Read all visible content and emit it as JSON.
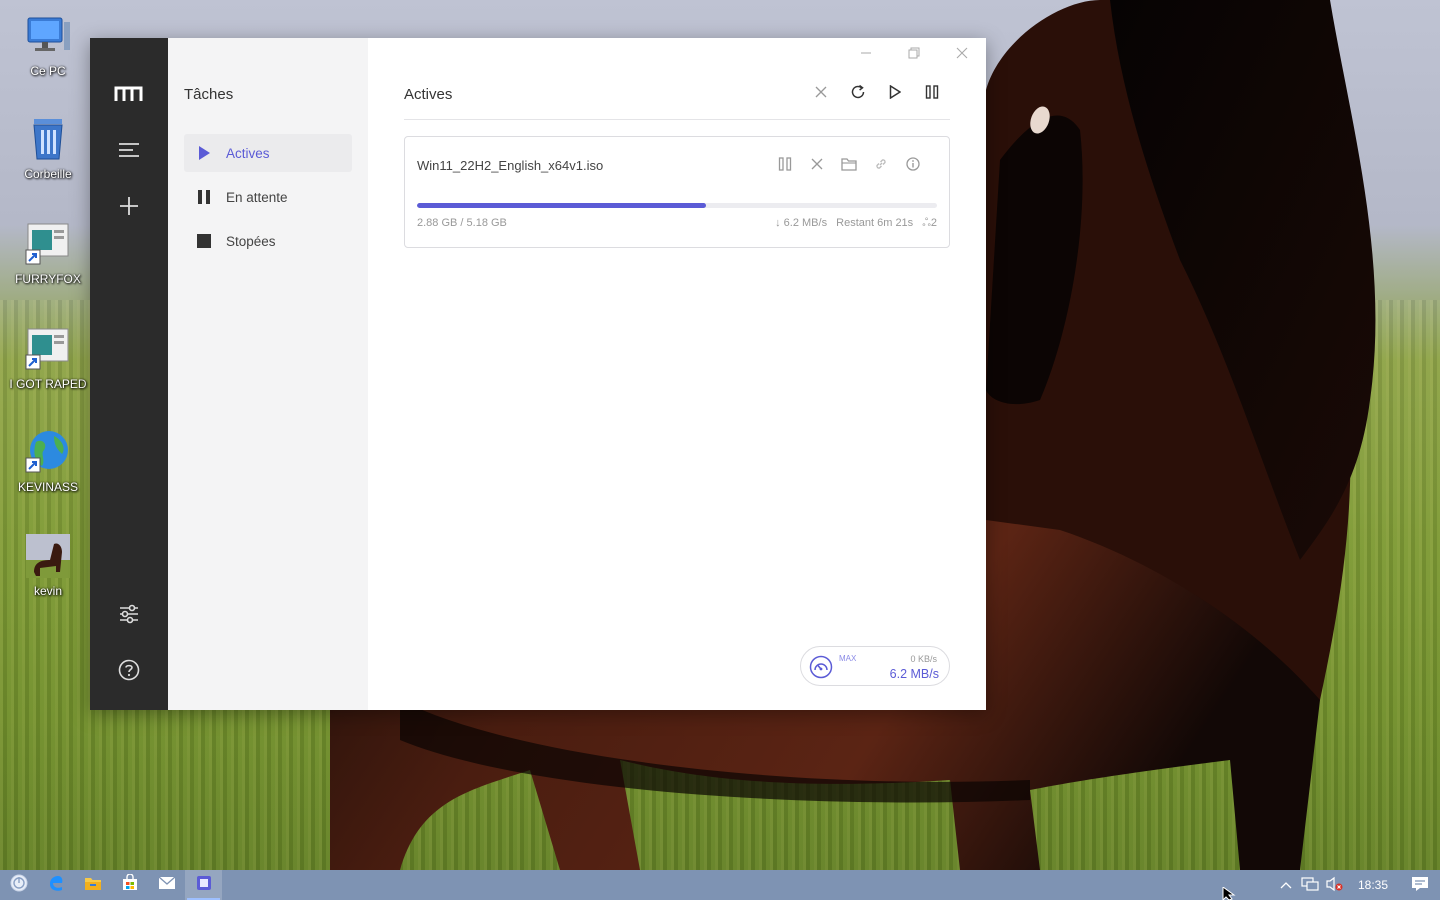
{
  "desktop": {
    "icons": [
      {
        "label": "Ce PC",
        "icon": "computer-icon"
      },
      {
        "label": "Corbeille",
        "icon": "recycle-bin-icon"
      },
      {
        "label": "FURRYFOX",
        "icon": "shortcut-icon"
      },
      {
        "label": "I GOT RAPED",
        "icon": "shortcut-icon"
      },
      {
        "label": "KEVINASS",
        "icon": "globe-shortcut-icon"
      },
      {
        "label": "kevin",
        "icon": "horse-image-icon"
      }
    ]
  },
  "app": {
    "rail": {
      "logo": "motrix-logo-icon",
      "items": [
        "menu-icon",
        "add-icon"
      ],
      "bottom": [
        "settings-icon",
        "help-icon"
      ]
    },
    "sidebar": {
      "title": "Tâches",
      "items": [
        {
          "label": "Actives",
          "icon": "play-icon",
          "active": true
        },
        {
          "label": "En attente",
          "icon": "pause-icon",
          "active": false
        },
        {
          "label": "Stopées",
          "icon": "stop-icon",
          "active": false
        }
      ]
    },
    "main": {
      "title": "Actives",
      "header_actions": [
        "close-icon",
        "refresh-icon",
        "play-icon",
        "pause-icon"
      ],
      "task": {
        "file_name": "Win11_22H2_English_x64v1.iso",
        "progress": 0.556,
        "size_text": "2.88 GB / 5.18 GB",
        "speed_text": "↓ 6.2 MB/s",
        "remaining_text": "Restant 6m 21s",
        "connections_text": "ஃ2",
        "actions": [
          "pause-icon",
          "delete-icon",
          "folder-icon",
          "link-icon",
          "info-icon"
        ]
      },
      "speedometer": {
        "max_label": "MAX",
        "upload": "0 KB/s",
        "download": "6.2 MB/s"
      }
    },
    "window_controls": [
      "minimize-icon",
      "maximize-icon",
      "close-icon"
    ]
  },
  "taskbar": {
    "apps": [
      "start-icon",
      "edge-icon",
      "file-explorer-icon",
      "store-icon",
      "mail-icon",
      "motrix-taskbar-icon"
    ],
    "clock": "18:35"
  },
  "colors": {
    "accent": "#5b5bd6",
    "rail": "#2b2b2b",
    "sidebar": "#f4f4f5",
    "taskbar": "#7e93b3"
  }
}
